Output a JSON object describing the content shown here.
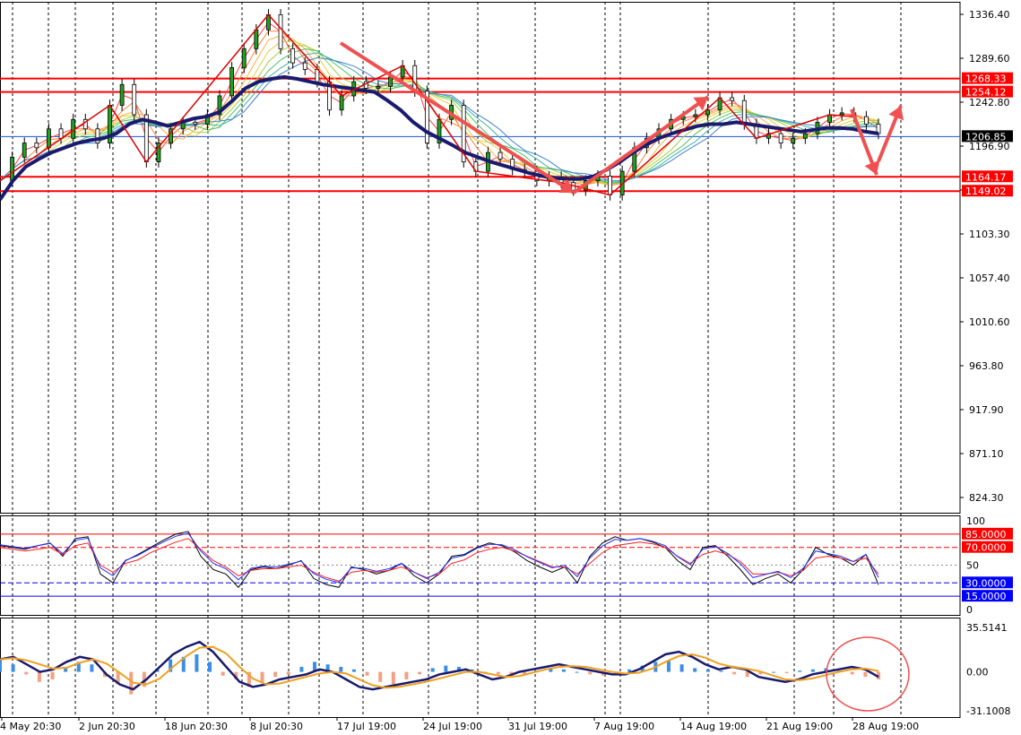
{
  "chart_data": {
    "type": "line",
    "main": {
      "y_ticks": [
        "1336.40",
        "1289.60",
        "1242.80",
        "1196.90",
        "1149.02",
        "1103.30",
        "1057.40",
        "1010.60",
        "963.80",
        "917.90",
        "871.10",
        "824.30"
      ],
      "ylim": [
        790,
        1345
      ],
      "price_labels": [
        {
          "value": 1268.33,
          "text": "1268.33",
          "bg": "#ff0000",
          "fg": "#ffffff"
        },
        {
          "value": 1254.12,
          "text": "1254.12",
          "bg": "#ff0000",
          "fg": "#ffffff"
        },
        {
          "value": 1206.85,
          "text": "1206.85",
          "bg": "#000000",
          "fg": "#ffffff"
        },
        {
          "value": 1164.17,
          "text": "1164.17",
          "bg": "#ff0000",
          "fg": "#ffffff"
        },
        {
          "value": 1149.02,
          "text": "1149.02",
          "bg": "#ff0000",
          "fg": "#ffffff"
        }
      ],
      "h_lines": [
        1268.33,
        1254.12,
        1164.17,
        1149.02
      ],
      "current_price": 1206.85,
      "close_series": [
        1160,
        1185,
        1200,
        1195,
        1215,
        1205,
        1225,
        1215,
        1200,
        1240,
        1262,
        1230,
        1180,
        1200,
        1215,
        1222,
        1220,
        1230,
        1250,
        1280,
        1300,
        1320,
        1336,
        1300,
        1285,
        1278,
        1265,
        1235,
        1250,
        1265,
        1258,
        1260,
        1270,
        1282,
        1255,
        1200,
        1225,
        1240,
        1180,
        1170,
        1190,
        1183,
        1172,
        1170,
        1160,
        1164,
        1158,
        1150,
        1160,
        1165,
        1145,
        1170,
        1195,
        1205,
        1215,
        1225,
        1228,
        1230,
        1235,
        1248,
        1245,
        1220,
        1205,
        1210,
        1200,
        1205,
        1210,
        1222,
        1230,
        1232,
        1228,
        1220,
        1210
      ],
      "sma_series": [
        1140,
        1160,
        1175,
        1183,
        1190,
        1195,
        1200,
        1203,
        1205,
        1210,
        1220,
        1225,
        1222,
        1218,
        1222,
        1226,
        1228,
        1233,
        1245,
        1258,
        1265,
        1268,
        1270,
        1268,
        1265,
        1262,
        1260,
        1258,
        1256,
        1254,
        1245,
        1235,
        1222,
        1212,
        1205,
        1198,
        1190,
        1185,
        1180,
        1176,
        1172,
        1168,
        1165,
        1163,
        1162,
        1162,
        1165,
        1172,
        1180,
        1190,
        1198,
        1205,
        1210,
        1214,
        1218,
        1220,
        1220,
        1222,
        1220,
        1218,
        1216,
        1214,
        1212,
        1214,
        1216,
        1216,
        1215,
        1212,
        1210
      ]
    },
    "rsi": {
      "y_ticks": [
        "100",
        "50",
        "0"
      ],
      "levels": [
        {
          "value": 85,
          "text": "85.0000",
          "bg": "#ff0000",
          "fg": "#ffffff"
        },
        {
          "value": 70,
          "text": "70.0000",
          "bg": "#ff0000",
          "fg": "#ffffff"
        },
        {
          "value": 30,
          "text": "30.0000",
          "bg": "#0000ff",
          "fg": "#ffffff"
        },
        {
          "value": 15,
          "text": "15.0000",
          "bg": "#0000ff",
          "fg": "#ffffff"
        }
      ],
      "fast": [
        72,
        70,
        68,
        72,
        75,
        60,
        80,
        82,
        40,
        30,
        55,
        62,
        70,
        78,
        85,
        88,
        60,
        45,
        40,
        25,
        45,
        48,
        46,
        50,
        55,
        35,
        28,
        25,
        48,
        45,
        40,
        44,
        52,
        38,
        30,
        40,
        60,
        62,
        70,
        75,
        72,
        65,
        55,
        48,
        42,
        48,
        30,
        60,
        75,
        82,
        78,
        80,
        76,
        70,
        55,
        45,
        70,
        72,
        60,
        45,
        28,
        35,
        40,
        30,
        45,
        70,
        62,
        58,
        50,
        62,
        28
      ],
      "slow": [
        70,
        68,
        66,
        68,
        70,
        62,
        72,
        75,
        50,
        42,
        52,
        56,
        64,
        70,
        76,
        80,
        68,
        55,
        48,
        38,
        44,
        46,
        46,
        48,
        50,
        42,
        36,
        32,
        42,
        44,
        42,
        44,
        48,
        42,
        36,
        40,
        52,
        56,
        64,
        68,
        70,
        66,
        60,
        54,
        48,
        48,
        40,
        52,
        64,
        72,
        74,
        76,
        74,
        70,
        60,
        52,
        62,
        66,
        62,
        54,
        40,
        40,
        42,
        38,
        44,
        58,
        60,
        58,
        54,
        58,
        40
      ]
    },
    "macd": {
      "y_ticks": [
        "35.5141",
        "0.00",
        "-31.1008"
      ],
      "ylim": [
        -31.1008,
        35.5141
      ],
      "hist": [
        10,
        6,
        -2,
        -8,
        -6,
        4,
        8,
        6,
        -4,
        -10,
        -18,
        -12,
        2,
        10,
        12,
        14,
        8,
        -3,
        -6,
        -12,
        -8,
        -4,
        -2,
        4,
        8,
        6,
        4,
        2,
        -3,
        -8,
        -10,
        -6,
        -2,
        3,
        5,
        4,
        2,
        0,
        -2,
        -4,
        -3,
        1,
        3,
        2,
        0,
        -2,
        -3,
        -1,
        2,
        5,
        8,
        9,
        6,
        3,
        2,
        1,
        -2,
        -4,
        -2,
        0,
        -1,
        1,
        2,
        3,
        1,
        -2,
        -4,
        -6
      ],
      "line": [
        10,
        12,
        6,
        0,
        2,
        8,
        12,
        10,
        -2,
        -10,
        -14,
        -6,
        4,
        14,
        20,
        24,
        16,
        4,
        -8,
        -12,
        -10,
        -6,
        -4,
        -2,
        2,
        0,
        -6,
        -12,
        -14,
        -12,
        -10,
        -8,
        -6,
        -2,
        0,
        2,
        -2,
        -6,
        -4,
        0,
        2,
        4,
        6,
        4,
        2,
        0,
        -2,
        -2,
        2,
        8,
        14,
        16,
        12,
        6,
        2,
        4,
        2,
        -4,
        -6,
        -8,
        -6,
        -2,
        0,
        2,
        4,
        2,
        -4
      ]
    },
    "x_tick_labels": [
      "4 May 20:30",
      "2 Jun 20:30",
      "18 Jun 20:30",
      "8 Jul 20:30",
      "17 Jul 19:00",
      "24 Jul 19:00",
      "31 Jul 19:00",
      "7 Aug 19:00",
      "14 Aug 19:00",
      "21 Aug 19:00",
      "28 Aug 19:00"
    ]
  }
}
